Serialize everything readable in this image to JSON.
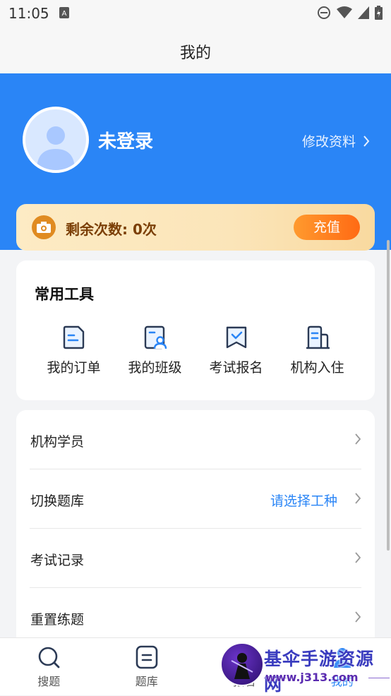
{
  "status_bar": {
    "time": "11:05",
    "sim_label": "A"
  },
  "header": {
    "title": "我的"
  },
  "profile": {
    "name": "未登录",
    "edit_label": "修改资料"
  },
  "quota": {
    "text": "剩余次数: 0次",
    "recharge_label": "充值"
  },
  "tools": {
    "heading": "常用工具",
    "items": [
      {
        "label": "我的订单",
        "icon": "order-icon"
      },
      {
        "label": "我的班级",
        "icon": "class-icon"
      },
      {
        "label": "考试报名",
        "icon": "exam-signup-icon"
      },
      {
        "label": "机构入住",
        "icon": "institution-icon"
      }
    ]
  },
  "menu": {
    "items": [
      {
        "label": "机构学员",
        "value": ""
      },
      {
        "label": "切换题库",
        "value": "请选择工种"
      },
      {
        "label": "考试记录",
        "value": ""
      },
      {
        "label": "重置练题",
        "value": ""
      }
    ]
  },
  "tabs": [
    {
      "label": "搜题",
      "icon": "search-icon"
    },
    {
      "label": "题库",
      "icon": "question-bank-icon"
    },
    {
      "label": "报名",
      "icon": "signup-icon"
    },
    {
      "label": "我的",
      "icon": "profile-icon"
    }
  ],
  "watermark": {
    "title": "基伞手游资源网",
    "url": "www.j313.com"
  },
  "colors": {
    "primary": "#2a85f6",
    "recharge": "#ff7a1f",
    "quota_text": "#7b3f06"
  }
}
